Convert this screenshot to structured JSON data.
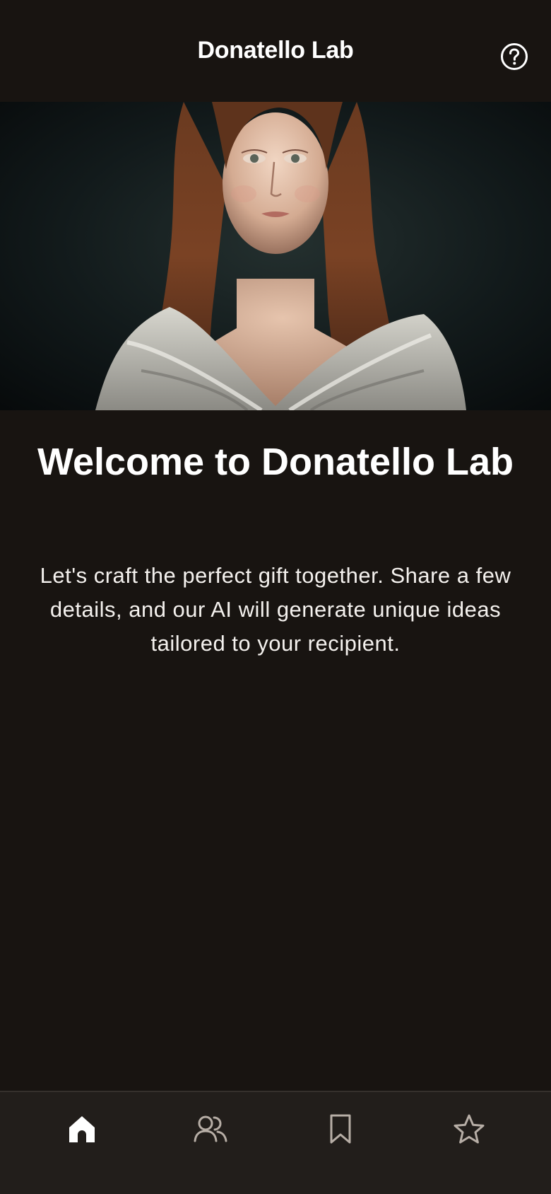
{
  "header": {
    "title": "Donatello Lab",
    "help_icon": "question-circle-icon"
  },
  "hero": {
    "image": "renaissance-portrait"
  },
  "welcome": {
    "title": "Welcome to Donatello Lab",
    "body": "Let's craft the perfect gift together. Share a few details, and our AI will generate unique ideas tailored to your recipient."
  },
  "tabbar": {
    "tabs": [
      {
        "icon": "home-icon",
        "active": true
      },
      {
        "icon": "people-icon",
        "active": false
      },
      {
        "icon": "bookmark-icon",
        "active": false
      },
      {
        "icon": "star-icon",
        "active": false
      }
    ],
    "active_color": "#ffffff",
    "inactive_color": "#b7aea6"
  },
  "colors": {
    "background": "#181411",
    "tabbar_background": "#221e1b"
  }
}
